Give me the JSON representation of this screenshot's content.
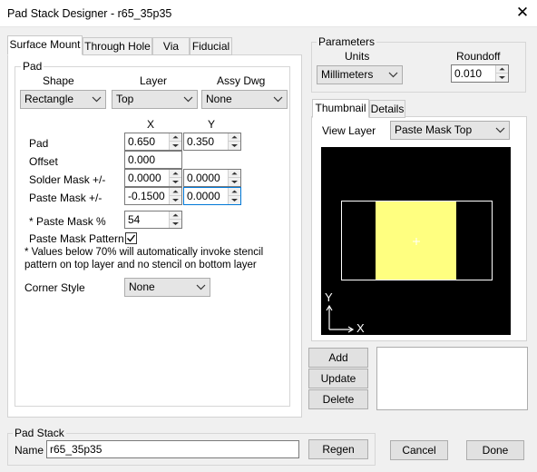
{
  "window": {
    "title": "Pad Stack Designer - r65_35p35",
    "close_glyph": "✕"
  },
  "tabs": [
    {
      "label": "Surface Mount",
      "active": true
    },
    {
      "label": "Through Hole"
    },
    {
      "label": "Via"
    },
    {
      "label": "Fiducial"
    }
  ],
  "pad": {
    "group_title": "Pad",
    "shape": {
      "label": "Shape",
      "value": "Rectangle"
    },
    "layer": {
      "label": "Layer",
      "value": "Top"
    },
    "assy_dwg": {
      "label": "Assy Dwg",
      "value": "None"
    },
    "x_header": "X",
    "y_header": "Y",
    "rows": {
      "pad": {
        "label": "Pad",
        "x": "0.650",
        "y": "0.350"
      },
      "offset": {
        "label": "Offset",
        "x": "0.000"
      },
      "solder_mask": {
        "label": "Solder Mask +/-",
        "x": "0.0000",
        "y": "0.0000"
      },
      "paste_mask": {
        "label": "Paste Mask +/-",
        "x": "-0.1500",
        "y": "0.0000"
      }
    },
    "paste_mask_pct": {
      "label": "* Paste Mask %",
      "value": "54"
    },
    "paste_mask_pattern": {
      "label": "Paste Mask Pattern",
      "checked": true
    },
    "note_line1": "* Values below 70% will automatically invoke stencil",
    "note_line2": "pattern on top layer and no stencil on bottom layer",
    "corner_style": {
      "label": "Corner Style",
      "value": "None"
    }
  },
  "parameters": {
    "group_title": "Parameters",
    "units_label": "Units",
    "units_value": "Millimeters",
    "roundoff_label": "Roundoff",
    "roundoff_value": "0.010"
  },
  "preview": {
    "tabs": [
      {
        "label": "Thumbnail",
        "active": true
      },
      {
        "label": "Details"
      }
    ],
    "view_layer_label": "View Layer",
    "view_layer_value": "Paste Mask Top",
    "axis_y": "Y",
    "axis_x": "X",
    "colors": {
      "background": "#000000",
      "pad_outline": "#ffffff",
      "paste": "#ffff80"
    }
  },
  "actions": {
    "add": "Add",
    "update": "Update",
    "delete": "Delete"
  },
  "pad_stack": {
    "group_title": "Pad Stack",
    "name_label": "Name",
    "name_value": "r65_35p35",
    "regen": "Regen"
  },
  "footer": {
    "cancel": "Cancel",
    "done": "Done"
  }
}
